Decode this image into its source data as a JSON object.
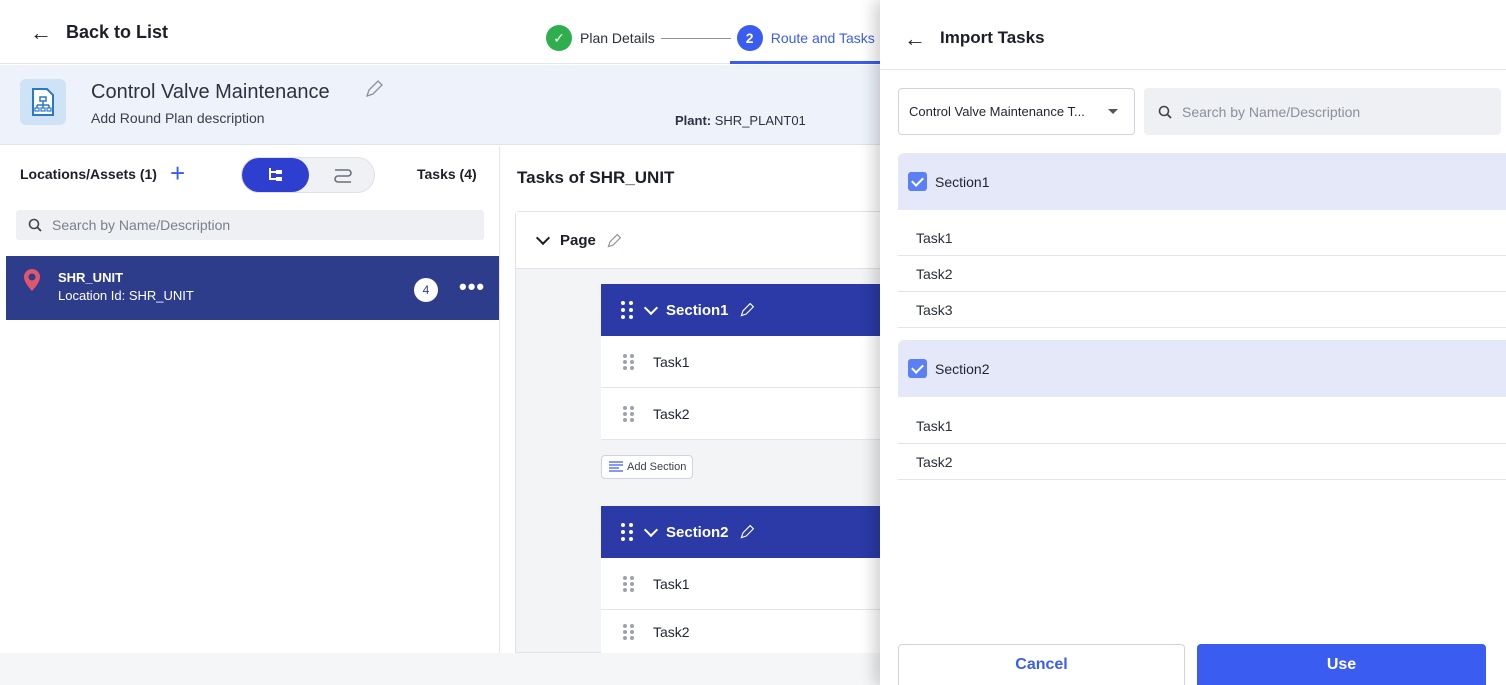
{
  "topbar": {
    "back_label": "Back to List",
    "steps": [
      {
        "number": "✓",
        "label": "Plan Details"
      },
      {
        "number": "2",
        "label": "Route and Tasks"
      }
    ]
  },
  "plan": {
    "title": "Control Valve Maintenance",
    "description": "Add Round Plan description",
    "plant_label": "Plant:",
    "plant_value": "SHR_PLANT01"
  },
  "left_panel": {
    "locations_title": "Locations/Assets (1)",
    "tasks_count": "Tasks (4)",
    "search_placeholder": "Search by Name/Description",
    "location": {
      "name": "SHR_UNIT",
      "id_text": "Location Id: SHR_UNIT",
      "badge": "4"
    }
  },
  "center_panel": {
    "title": "Tasks of SHR_UNIT",
    "page_label": "Page",
    "sections": [
      {
        "name": "Section1",
        "tasks": [
          "Task1",
          "Task2"
        ]
      },
      {
        "name": "Section2",
        "tasks": [
          "Task1",
          "Task2"
        ]
      }
    ],
    "add_section_label": "Add Section"
  },
  "drawer": {
    "title": "Import Tasks",
    "template_select": "Control Valve Maintenance T...",
    "search_placeholder": "Search by Name/Description",
    "sections": [
      {
        "name": "Section1",
        "checked": true,
        "tasks": [
          "Task1",
          "Task2",
          "Task3"
        ]
      },
      {
        "name": "Section2",
        "checked": true,
        "tasks": [
          "Task1",
          "Task2"
        ]
      }
    ],
    "cancel_label": "Cancel",
    "use_label": "Use"
  },
  "colors": {
    "primary": "#3b5cf0",
    "section_header": "#2b3aa6",
    "selected_location": "#2e3c8c",
    "done_step": "#2fae4e",
    "import_section_bg": "#e4e8f8"
  }
}
